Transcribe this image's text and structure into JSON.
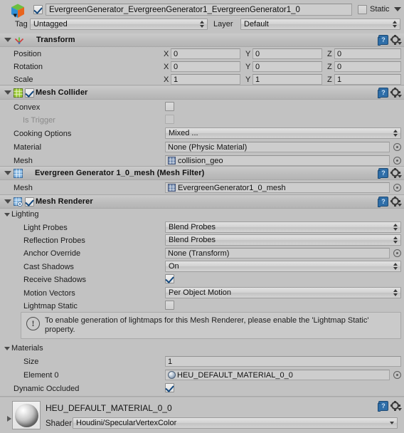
{
  "object_header": {
    "icon": "cube-icon",
    "enabled": true,
    "name": "EvergreenGenerator_EvergreenGenerator1_EvergreenGenerator1_0",
    "static_label": "Static",
    "static_checked": false,
    "tag_label": "Tag",
    "tag_value": "Untagged",
    "layer_label": "Layer",
    "layer_value": "Default"
  },
  "transform": {
    "title": "Transform",
    "icon": "transform-gizmo-icon",
    "rows": [
      {
        "label": "Position",
        "x": "0",
        "y": "0",
        "z": "0"
      },
      {
        "label": "Rotation",
        "x": "0",
        "y": "0",
        "z": "0"
      },
      {
        "label": "Scale",
        "x": "1",
        "y": "1",
        "z": "1"
      }
    ],
    "axis_labels": {
      "x": "X",
      "y": "Y",
      "z": "Z"
    }
  },
  "mesh_collider": {
    "title": "Mesh Collider",
    "icon": "mesh-collider-icon",
    "enabled": true,
    "convex_label": "Convex",
    "convex_checked": false,
    "is_trigger_label": "Is Trigger",
    "is_trigger_checked": false,
    "is_trigger_disabled": true,
    "cooking_options_label": "Cooking Options",
    "cooking_options_value": "Mixed ...",
    "material_label": "Material",
    "material_value": "None (Physic Material)",
    "mesh_label": "Mesh",
    "mesh_value": "collision_geo"
  },
  "mesh_filter": {
    "title": "Evergreen Generator 1_0_mesh (Mesh Filter)",
    "icon": "mesh-filter-icon",
    "mesh_label": "Mesh",
    "mesh_value": "EvergreenGenerator1_0_mesh"
  },
  "mesh_renderer": {
    "title": "Mesh Renderer",
    "icon": "mesh-renderer-icon",
    "enabled": true,
    "lighting_section": "Lighting",
    "lighting_rows": [
      {
        "label": "Light Probes",
        "type": "popup",
        "value": "Blend Probes"
      },
      {
        "label": "Reflection Probes",
        "type": "popup",
        "value": "Blend Probes"
      },
      {
        "label": "Anchor Override",
        "type": "object",
        "value": "None (Transform)"
      },
      {
        "label": "Cast Shadows",
        "type": "popup",
        "value": "On"
      },
      {
        "label": "Receive Shadows",
        "type": "toggle",
        "value": true
      },
      {
        "label": "Motion Vectors",
        "type": "popup",
        "value": "Per Object Motion"
      },
      {
        "label": "Lightmap Static",
        "type": "toggle",
        "value": false
      }
    ],
    "info_message": "To enable generation of lightmaps for this Mesh Renderer, please enable the 'Lightmap Static' property.",
    "materials_section": "Materials",
    "size_label": "Size",
    "size_value": "1",
    "element0_label": "Element 0",
    "element0_value": "HEU_DEFAULT_MATERIAL_0_0",
    "dynamic_occluded_label": "Dynamic Occluded",
    "dynamic_occluded_checked": true
  },
  "material": {
    "title": "HEU_DEFAULT_MATERIAL_0_0",
    "shader_label": "Shader",
    "shader_value": "Houdini/SpecularVertexColor"
  },
  "colors": {
    "background": "#c2c2c2",
    "header_gradient_top": "#cbcbcb",
    "field_bg": "#cfcfcf",
    "checkbox_check": "#12477d",
    "accent_blue": "#2f6ea8"
  }
}
